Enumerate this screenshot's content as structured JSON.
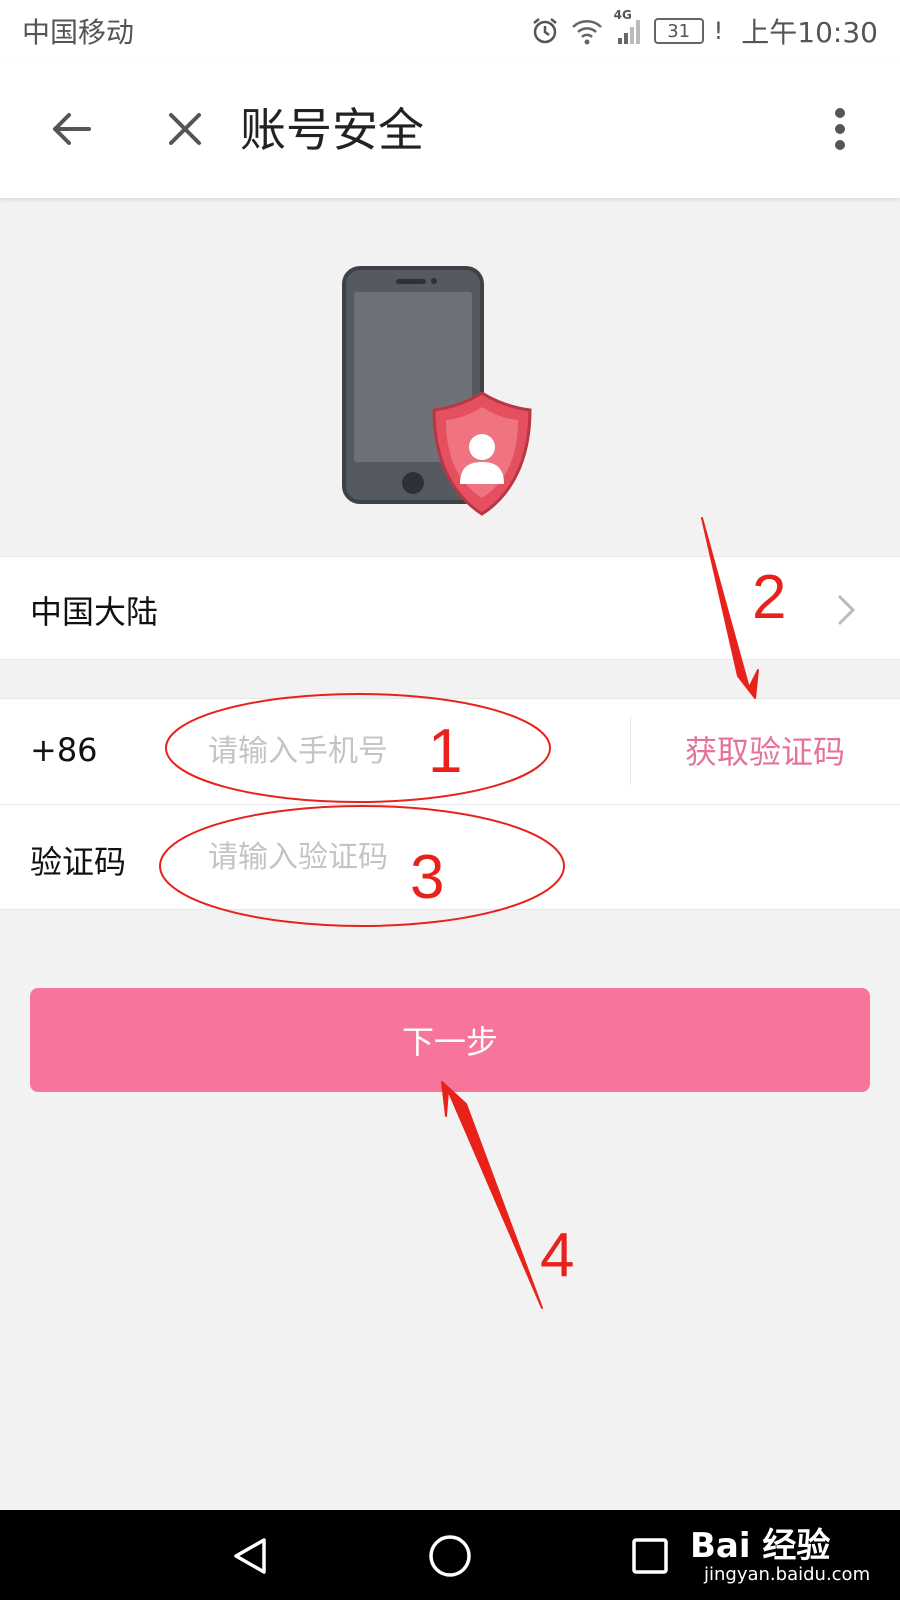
{
  "status_bar": {
    "carrier": "中国移动",
    "network": "4G",
    "battery": "31",
    "warning": "!",
    "time": "上午10:30",
    "icons": [
      "alarm-icon",
      "wifi-icon",
      "signal-icon",
      "battery-icon"
    ]
  },
  "app_bar": {
    "title": "账号安全",
    "back_icon": "arrow-left-icon",
    "close_icon": "close-icon",
    "more_icon": "more-vertical-icon"
  },
  "illustration": {
    "icon": "phone-shield-user-icon",
    "colors": {
      "phone": "#555a60",
      "screen": "#6d7278",
      "shield": "#e4505f"
    }
  },
  "region": {
    "label": "中国大陆",
    "chevron_icon": "chevron-right-icon"
  },
  "phone_field": {
    "country_code": "+86",
    "value": "",
    "placeholder": "请输入手机号",
    "get_code_label": "获取验证码"
  },
  "code_field": {
    "label": "验证码",
    "value": "",
    "placeholder": "请输入验证码"
  },
  "next_button": {
    "label": "下一步",
    "color": "#f7749a"
  },
  "annotations": {
    "step1": "1",
    "step2": "2",
    "step3": "3",
    "step4": "4",
    "color": "#e8221b"
  },
  "nav_bar": {
    "icons": [
      "back-triangle-icon",
      "home-circle-icon",
      "recents-square-icon"
    ]
  },
  "watermark": {
    "brand": "Bai 经验",
    "url": "jingyan.baidu.com",
    "icon": "paw-icon"
  },
  "colors": {
    "accent": "#e5749a",
    "background": "#f2f2f2"
  }
}
